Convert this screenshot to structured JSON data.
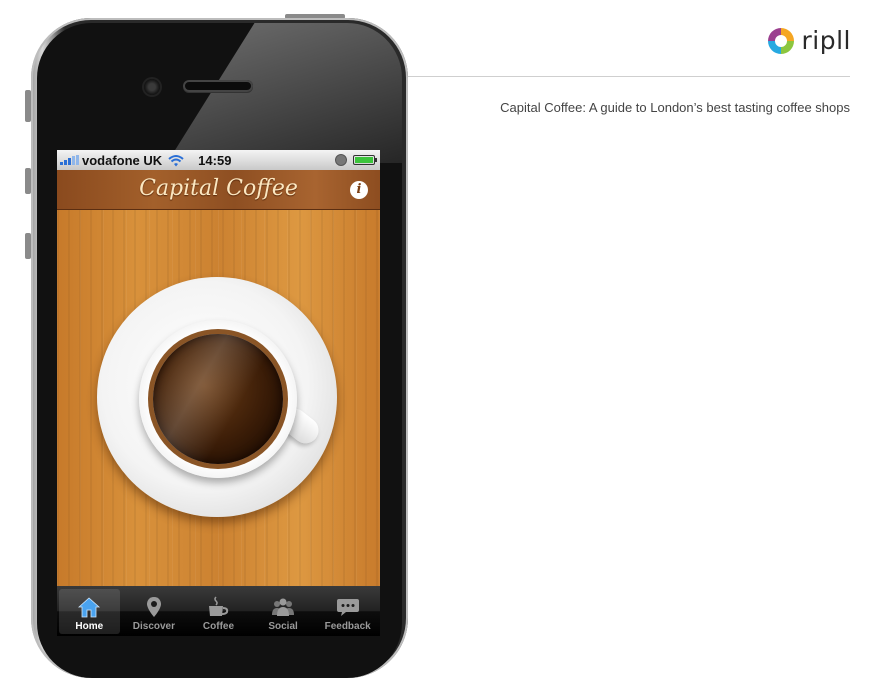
{
  "brand": {
    "name": "ripll",
    "logo_icon": "ripll-logo-icon"
  },
  "caption": "Capital Coffee: A guide to London’s best tasting coffee shops",
  "status_bar": {
    "carrier": "vodafone UK",
    "time": "14:59"
  },
  "app": {
    "title": "Capital Coffee",
    "info_label": "i"
  },
  "tabs": [
    {
      "label": "Home",
      "icon": "home-icon",
      "active": true
    },
    {
      "label": "Discover",
      "icon": "location-pin-icon",
      "active": false
    },
    {
      "label": "Coffee",
      "icon": "coffee-cup-icon",
      "active": false
    },
    {
      "label": "Social",
      "icon": "people-icon",
      "active": false
    },
    {
      "label": "Feedback",
      "icon": "speech-bubble-icon",
      "active": false
    }
  ],
  "colors": {
    "wood": "#d08a36",
    "nav_text": "#fbe7c1",
    "tab_active_icon": "#4aa3ef",
    "tab_inactive": "#9a9a9a"
  }
}
